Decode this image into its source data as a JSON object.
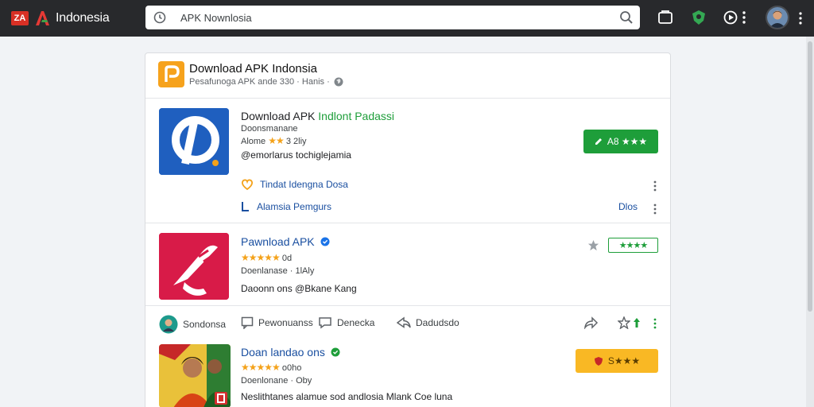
{
  "topbar": {
    "brand_badge": "ZA",
    "brand_name": "Indonesia",
    "search_value": "APK Nownlosia",
    "icons": [
      "clock-icon",
      "search-icon",
      "folder-icon",
      "extension-icon",
      "play-icon",
      "more-icon"
    ]
  },
  "header": {
    "title": "Download APK Indonsia",
    "subtitle": "Pesafunoga APK ande 330 · Hanis ·"
  },
  "apps": [
    {
      "title_black": "Download APK",
      "title_green": "Indlont Padassi",
      "line1": "Doonsmanane",
      "line2_prefix": "Alome",
      "stars": "★★",
      "line2_suffix": "3 2liy",
      "description": "@emorlarus tochiglejamia",
      "button_label": "A8 ★★★",
      "link1": "Tindat Idengna Dosa",
      "link2": "Alamsia Pemgurs",
      "link2_action": "Dlos"
    },
    {
      "title": "Pawnload APK",
      "stars": "★★★★★",
      "rating": "0d",
      "line2": "Doenlanase · 1lAly",
      "description": "Daoonn ons @Bkane Kang",
      "button_label": "★★★★"
    },
    {
      "title": "Doan landao ons",
      "stars": "★★★★★",
      "rating": "o0ho",
      "line2": "Doenlonane · Oby",
      "description": "Neslithtanes alamue sod andlosia Mlank Coe luna",
      "button_label": "S★★★"
    }
  ],
  "actions": {
    "user": "Sondonsa",
    "comment": "Pewonuanss",
    "reply": "Denecka",
    "share": "Dadudsdo"
  },
  "colors": {
    "accent_green": "#1e9e3a",
    "link_blue": "#1a4fa0",
    "star_orange": "#f4a21a",
    "button_yellow": "#f9b824"
  }
}
